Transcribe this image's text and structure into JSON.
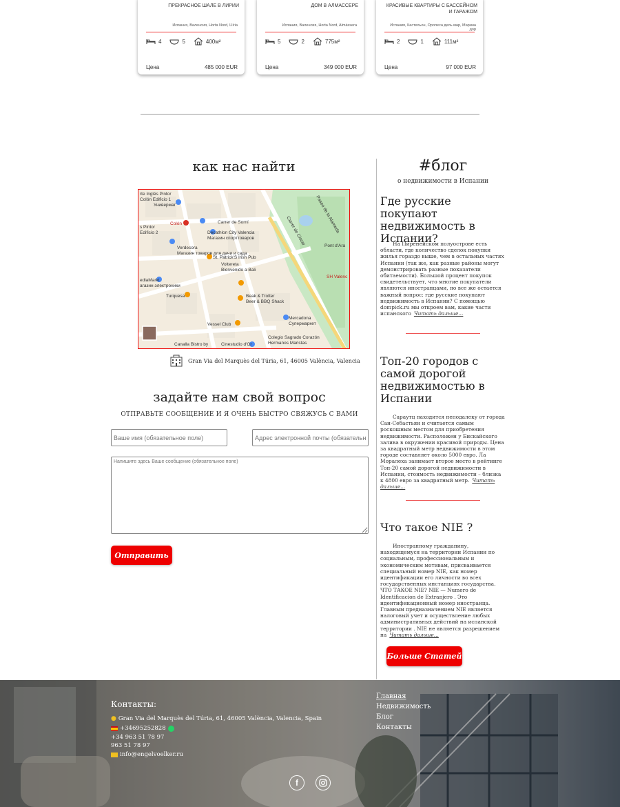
{
  "cards": [
    {
      "title": "ПРЕКРАСНОЕ ШАЛЕ В ЛИРИИ",
      "location": "Испания, Валенсия, Horta Nord, Llíria",
      "beds": "4",
      "baths": "5",
      "area": "400м²",
      "price_label": "Цена",
      "price": "485 000 EUR"
    },
    {
      "title": "ДОМ В АЛМАССЕРЕ",
      "location": "Испания, Валенсия, Horta Nord, Almàssera",
      "beds": "5",
      "baths": "2",
      "area": "775м²",
      "price_label": "Цена",
      "price": "349 000 EUR"
    },
    {
      "title": "КРАСИВЫЕ КВАРТИРЫ С БАССЕЙНОМ И ГАРАЖОМ",
      "location": "Испания, Кастельон, Оропеса дель мар, Марина дор",
      "beds": "2",
      "baths": "1",
      "area": "111м²",
      "price_label": "Цена",
      "price": "97 000 EUR"
    }
  ],
  "find": {
    "title": "как нас найти",
    "address": "Gran Via del Marquès del Túria, 61, 46005 València, Valencia",
    "map_labels": [
      "rte Inglés Pintor",
      "Colón Edificio 1",
      "Универмаг",
      "Colón",
      "Carrer de Sorní",
      "Decathlon City Valencia",
      "Магазин спорттоваров",
      "Paseo de la Alameda",
      "s Pintor",
      "Edificio 2",
      "Verdecora",
      "Магазин товаров для дачи и сада",
      "Pont d'Ara",
      "St. Patrick'S Irish Pub",
      "Voltereta",
      "Bienvenido a Bali",
      "ediaMarkt",
      "агазин электроники",
      "SH Valenc",
      "Turquesa",
      "Beak & Trotter",
      "Beer & BBQ Shack",
      "Mercadona",
      "Супермаркет",
      "Vessel Club",
      "Colegio Sagrado Corazón",
      "Hermanos Maristas",
      "Canalla Bistro by",
      "Cinestudio d'Or",
      "Carrer de Ciscar"
    ]
  },
  "ask": {
    "title": "задайте нам свой вопрос",
    "subtitle": "ОТПРАВЬТЕ СООБЩЕНИЕ И Я ОЧЕНЬ БЫСТРО СВЯЖУСЬ С ВАМИ",
    "name_placeholder": "Ваше имя (обязательное поле)",
    "email_placeholder": "Адрес электронной почты (обязательно",
    "message_placeholder": "Напишите здесь Ваше сообщение (обязательное поле)",
    "send_label": "Отправить"
  },
  "blog": {
    "title": "#блог",
    "subtitle": "о недвижимости в Испании",
    "posts": [
      {
        "title": "Где русские покупают недвижимость в Испании?",
        "text": "На Пиренейском полуострове есть области, где количество сделок покупки жилья гораздо выше, чем в остальных частях Испании (так же, как разные районы могут демонстрировать разные показатели обитаемости). Большой процент покупок свидетельствует, что многие покупатели являются иностранцами, но все же остается важный вопрос: где русские покупают недвижимость в Испании? С помощью dompick.ru мы откроем вам, какие части испанского",
        "more": "Читать дальше..."
      },
      {
        "title": "Топ-20 городов с самой дорогой недвижимостью в Испании",
        "text": "Сараутц находится неподалеку от города Сан-Себастьян и считается самым роскошным местом для приобретения недвижимости. Расположен у Бискайского залива в окружении красивой природы. Цена за квадратный метр недвижимости в этом городе составляет около 5000 евро. Ла Моралеха занимает второе место в рейтинге Топ-20 самой дорогой недвижимости в Испании, стоимость недвижимости – близка к 4800 евро за квадратный метр.",
        "more": "Читать дальше..."
      },
      {
        "title": "Что такое NIE ?",
        "text": "Иностранному гражданину, находящемуся на территории Испании по социальным, профессиональным и экономическим мотивам, присваивается специальный номер NIE, как номер идентификации его личности во всех государственных инстанциях государства. ЧТО ТАКОЕ NIE? NIE — Numero de Identificacion de Extranjero . Это идентификационный номер иностранца. Главным предназначением NIE является налоговый учет и осуществление любых административных действий на испанской территории . NIE не является разрешением на",
        "more": "Читать дальше..."
      }
    ],
    "more_button": "Больше Статей"
  },
  "footer": {
    "contacts_title": "Контакты:",
    "address": "Gran Via del Marquès del Túria, 61, 46005 València, Valencia, Spain",
    "phone_whatsapp": "+34695252828",
    "phone2": "+34 963 51 78 97",
    "phone3": "963 51 78 97",
    "email": "info@engelvoelker.ru",
    "nav": [
      "Главная",
      "Недвижимость",
      "Блог",
      "Контакты"
    ]
  },
  "colors": {
    "accent": "#ee0000",
    "divider": "#e55555"
  }
}
